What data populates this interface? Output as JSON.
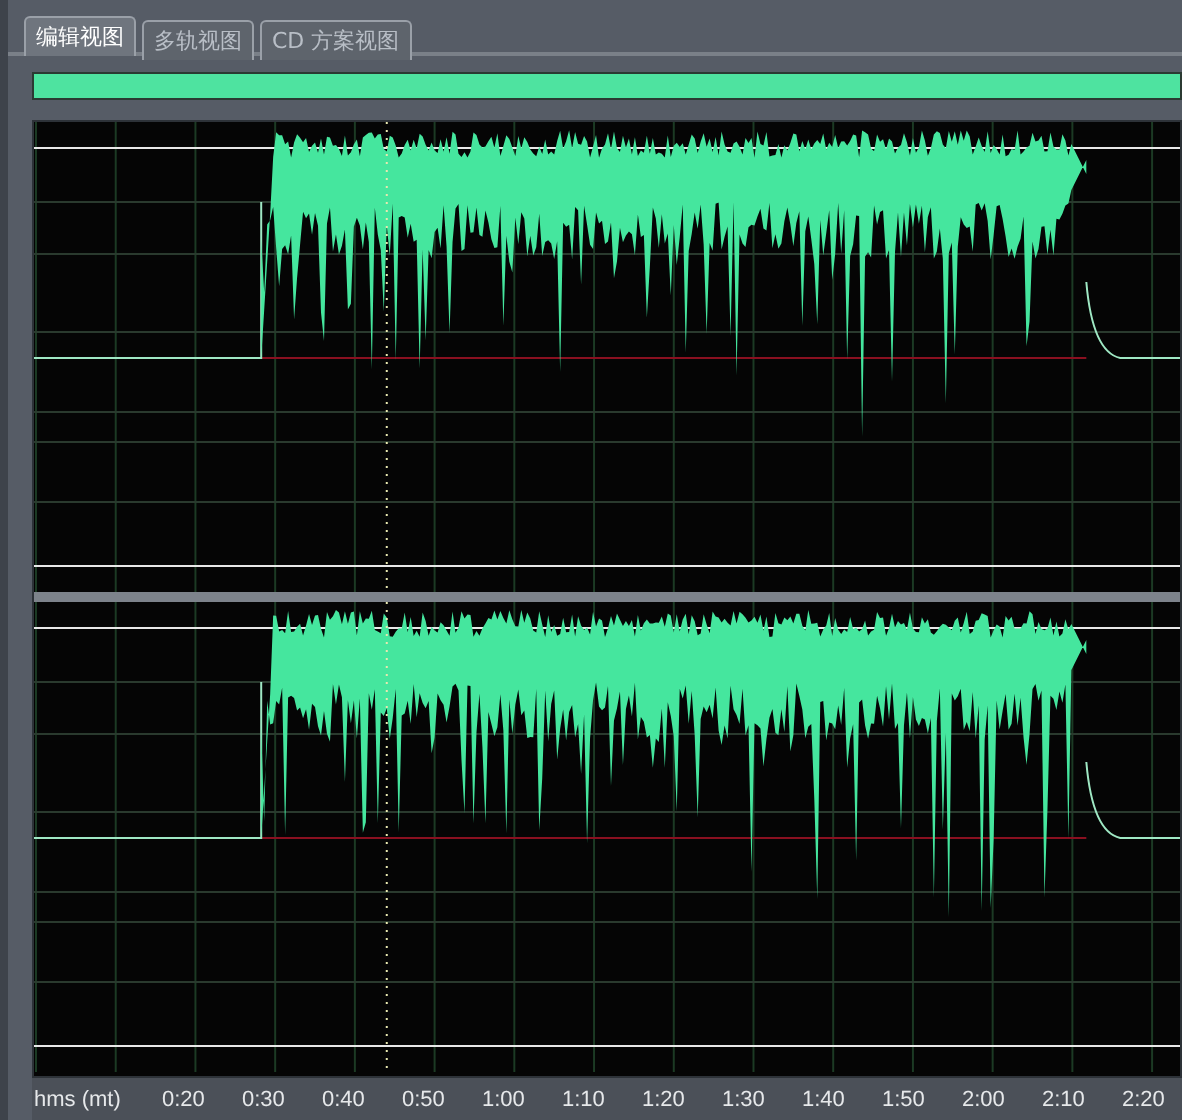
{
  "tabs": [
    {
      "label": "编辑视图",
      "selected": true
    },
    {
      "label": "多轨视图",
      "selected": false
    },
    {
      "label": "CD 方案视图",
      "selected": false
    }
  ],
  "ruler": {
    "unit": "hms (mt)",
    "labels": [
      "0:20",
      "0:30",
      "0:40",
      "0:50",
      "1:00",
      "1:10",
      "1:20",
      "1:30",
      "1:40",
      "1:50",
      "2:00",
      "2:10",
      "2:20"
    ]
  }
}
